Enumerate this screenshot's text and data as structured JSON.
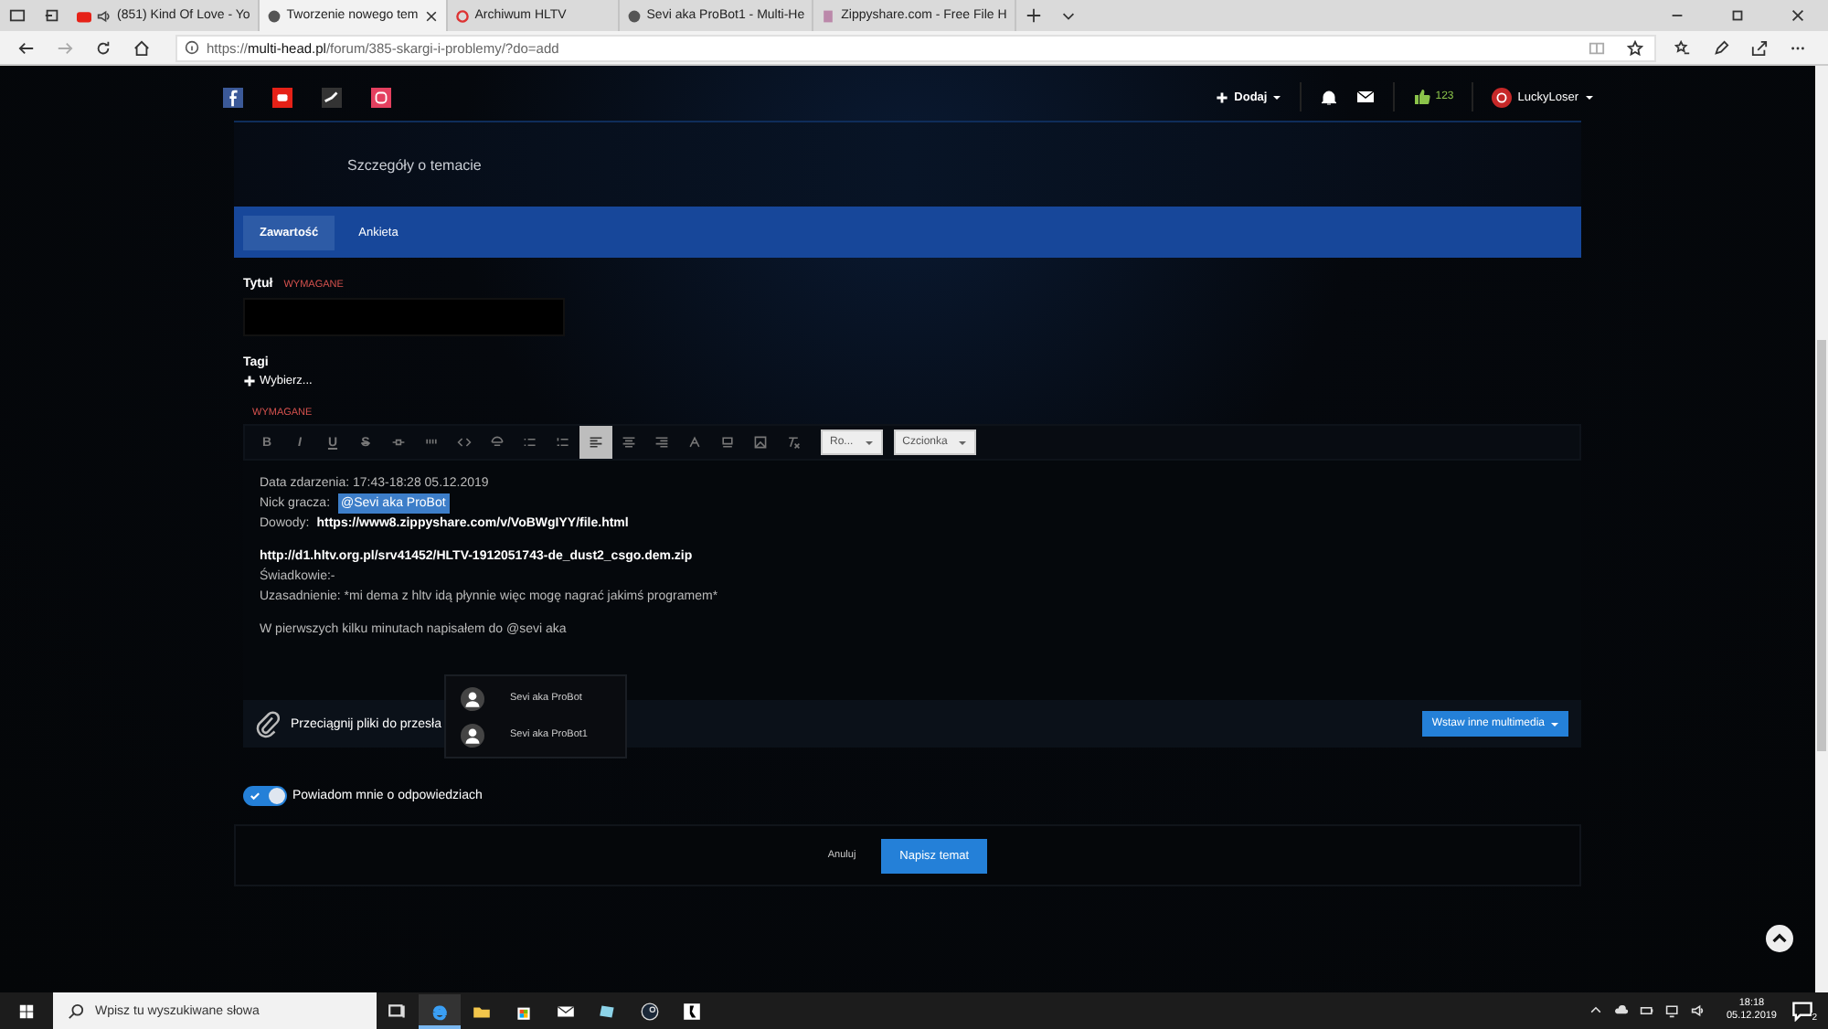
{
  "browser": {
    "tabs": [
      {
        "title": "(851) Kind Of Love - Yo",
        "kind": "video",
        "audio": true,
        "selected": false
      },
      {
        "title": "Tworzenie nowego tem",
        "kind": "site",
        "audio": false,
        "selected": true
      },
      {
        "title": "Archiwum HLTV",
        "kind": "ring",
        "audio": false,
        "selected": false
      },
      {
        "title": "Sevi aka ProBot1 - Multi-He",
        "kind": "site",
        "audio": false,
        "selected": false
      },
      {
        "title": "Zippyshare.com - Free File H",
        "kind": "zip",
        "audio": false,
        "selected": false
      }
    ],
    "address": "https://**multi-head.pl**/forum/385-skargi-i-problemy/?do=add"
  },
  "site_header": {
    "socials": [
      {
        "kind": "facebook",
        "color": "#3b5998"
      },
      {
        "kind": "youtube",
        "color": "#e62117"
      },
      {
        "kind": "steam",
        "color": "#333333"
      },
      {
        "kind": "instagram",
        "color": "#e4405f"
      }
    ],
    "add_label": "Dodaj",
    "reputation": "123",
    "username": "LuckyLoser"
  },
  "banner": {
    "title": "Szczegóły o temacie"
  },
  "tabs": [
    {
      "label": "Zawartość",
      "selected": true
    },
    {
      "label": "Ankieta",
      "selected": false
    }
  ],
  "form": {
    "title_label": "Tytuł",
    "title_required": "WYMAGANE",
    "tags_label": "Tagi",
    "tags_add": "Wybierz...",
    "content_required": "WYMAGANE",
    "toolbar": [
      {
        "kind": "letter",
        "label": "B",
        "selected": false
      },
      {
        "kind": "letter",
        "label": "I",
        "selected": false
      },
      {
        "kind": "letter",
        "label": "U",
        "selected": false
      },
      {
        "kind": "letter",
        "label": "S",
        "selected": false
      },
      {
        "kind": "link",
        "selected": false
      },
      {
        "kind": "quote",
        "selected": false
      },
      {
        "kind": "code",
        "selected": false
      },
      {
        "kind": "spoiler",
        "selected": false
      },
      {
        "kind": "bullets",
        "selected": false
      },
      {
        "kind": "numbers",
        "selected": false
      },
      {
        "kind": "align-left",
        "selected": true
      },
      {
        "kind": "align-center",
        "selected": false
      },
      {
        "kind": "align-right",
        "selected": false
      },
      {
        "kind": "font-color",
        "selected": false
      },
      {
        "kind": "background",
        "selected": false
      },
      {
        "kind": "image",
        "selected": false
      },
      {
        "kind": "clear",
        "selected": false
      }
    ],
    "dropdowns": [
      "Ro...",
      "Czcionka"
    ],
    "paragraphs": [
      {
        "lines": [
          {
            "parts": [
              {
                "kind": "text",
                "text": "Data zdarzenia: 17:43-18:28 05.12.2019"
              }
            ]
          },
          {
            "parts": [
              {
                "kind": "text",
                "text": "Nick gracza:"
              },
              {
                "kind": "mention",
                "text": "@Sevi aka ProBot"
              }
            ]
          },
          {
            "parts": [
              {
                "kind": "text",
                "text": "Dowody:"
              },
              {
                "kind": "link",
                "text": "https://www8.zippyshare.com/v/VoBWgIYY/file.html"
              }
            ]
          }
        ]
      },
      {
        "lines": [
          {
            "parts": [
              {
                "kind": "link",
                "text": "http://d1.hltv.org.pl/srv41452/HLTV-1912051743-de_dust2_csgo.dem.zip"
              }
            ]
          },
          {
            "parts": [
              {
                "kind": "text",
                "text": "Świadkowie:-"
              }
            ]
          },
          {
            "parts": [
              {
                "kind": "text",
                "text": "Uzasadnienie: *mi dema z hltv idą płynnie więc mogę nagrać jakimś programem*"
              }
            ]
          }
        ]
      },
      {
        "lines": [
          {
            "parts": [
              {
                "kind": "text",
                "text": "W pierwszych kilku minutach napisałem do @sevi aka"
              }
            ]
          }
        ]
      }
    ],
    "mention_suggestions": [
      {
        "name": "Sevi aka ProBot"
      },
      {
        "name": "Sevi aka ProBot1"
      }
    ],
    "upload_text": "Przeciągnij pliki do przesła",
    "multimedia_button": "Wstaw inne multimedia",
    "notify": {
      "label": "Powiadom mnie o odpowiedziach",
      "on": true
    },
    "cancel": "Anuluj",
    "submit": "Napisz temat"
  },
  "taskbar": {
    "search_placeholder": "Wpisz tu wyszukiwane słowa",
    "time": "18:18",
    "date": "05.12.2019",
    "notifications": "2"
  }
}
